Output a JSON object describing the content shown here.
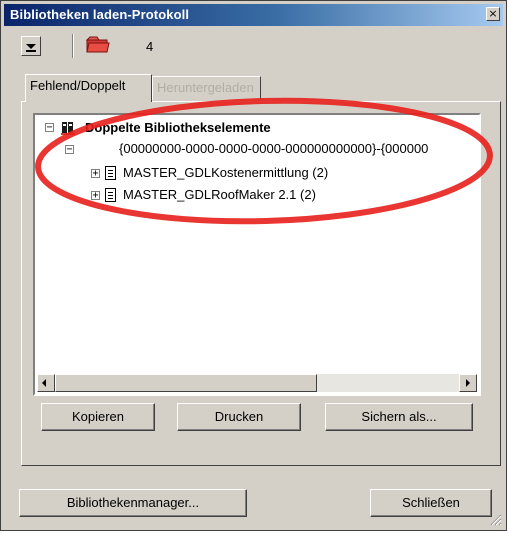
{
  "window": {
    "title": "Bibliotheken laden-Protokoll",
    "close_glyph": "×"
  },
  "toolbar": {
    "count": "4",
    "dropdown_icon": "dropdown-arrow-icon",
    "folder_icon": "folder-icon"
  },
  "tabs": [
    {
      "label": "Fehlend/Doppelt",
      "active": true
    },
    {
      "label": "Heruntergeladen",
      "active": false
    }
  ],
  "tree": {
    "root": {
      "label": "Doppelte Bibliothekselemente",
      "expander": "−"
    },
    "guid": {
      "label": "{00000000-0000-0000-0000-000000000000}-{000000",
      "expander": "−"
    },
    "items": [
      {
        "label": "MASTER_GDLKostenermittlung  (2)",
        "expander": "+"
      },
      {
        "label": "MASTER_GDLRoofMaker 2.1  (2)",
        "expander": "+"
      }
    ]
  },
  "buttons": {
    "copy": "Kopieren",
    "print": "Drucken",
    "save_as": "Sichern als...",
    "library_manager": "Bibliothekenmanager...",
    "close": "Schließen"
  },
  "colors": {
    "face": "#d4d0c8",
    "title_start": "#0a246a",
    "title_end": "#a6caf0",
    "annotation": "#e8201c"
  }
}
